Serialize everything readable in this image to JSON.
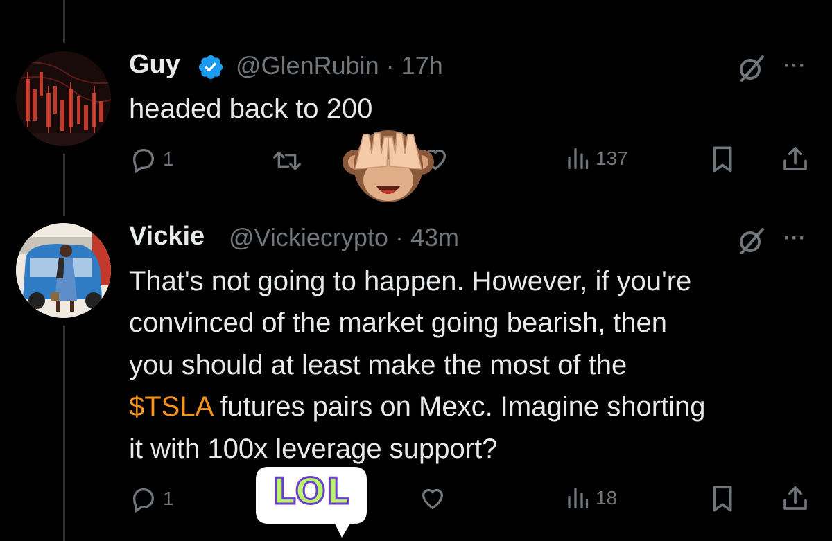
{
  "tweets": [
    {
      "name": "Guy",
      "handle": "@GlenRubin",
      "time": "17h",
      "text_lines": [
        "headed back to 200"
      ],
      "replies": "1",
      "views": "137"
    },
    {
      "name": "Vickie",
      "handle": "@Vickiecrypto",
      "time": "43m",
      "text_lines": [
        "That's not going to happen. However, if you're",
        "convinced of the market going bearish, then",
        "you should at least make the most of the"
      ],
      "cashtag": "$TSLA",
      "line4_rest": " futures pairs on Mexc. Imagine shorting",
      "line5": "it with 100x leverage support?",
      "replies": "1",
      "views": "18"
    }
  ],
  "sticker": {
    "lol_text": "LOL"
  },
  "separator": " · ",
  "more_glyph": "···",
  "colors": {
    "background": "#000000",
    "text": "#e7e9ea",
    "muted": "#71767b",
    "verified": "#1d9bf0",
    "cashtag": "#f7931a"
  },
  "icons": [
    "verified-badge-icon",
    "grok-icon",
    "more-icon",
    "reply-icon",
    "retweet-icon",
    "like-icon",
    "views-icon",
    "bookmark-icon",
    "share-icon",
    "see-no-evil-monkey-icon",
    "lol-sticker"
  ]
}
